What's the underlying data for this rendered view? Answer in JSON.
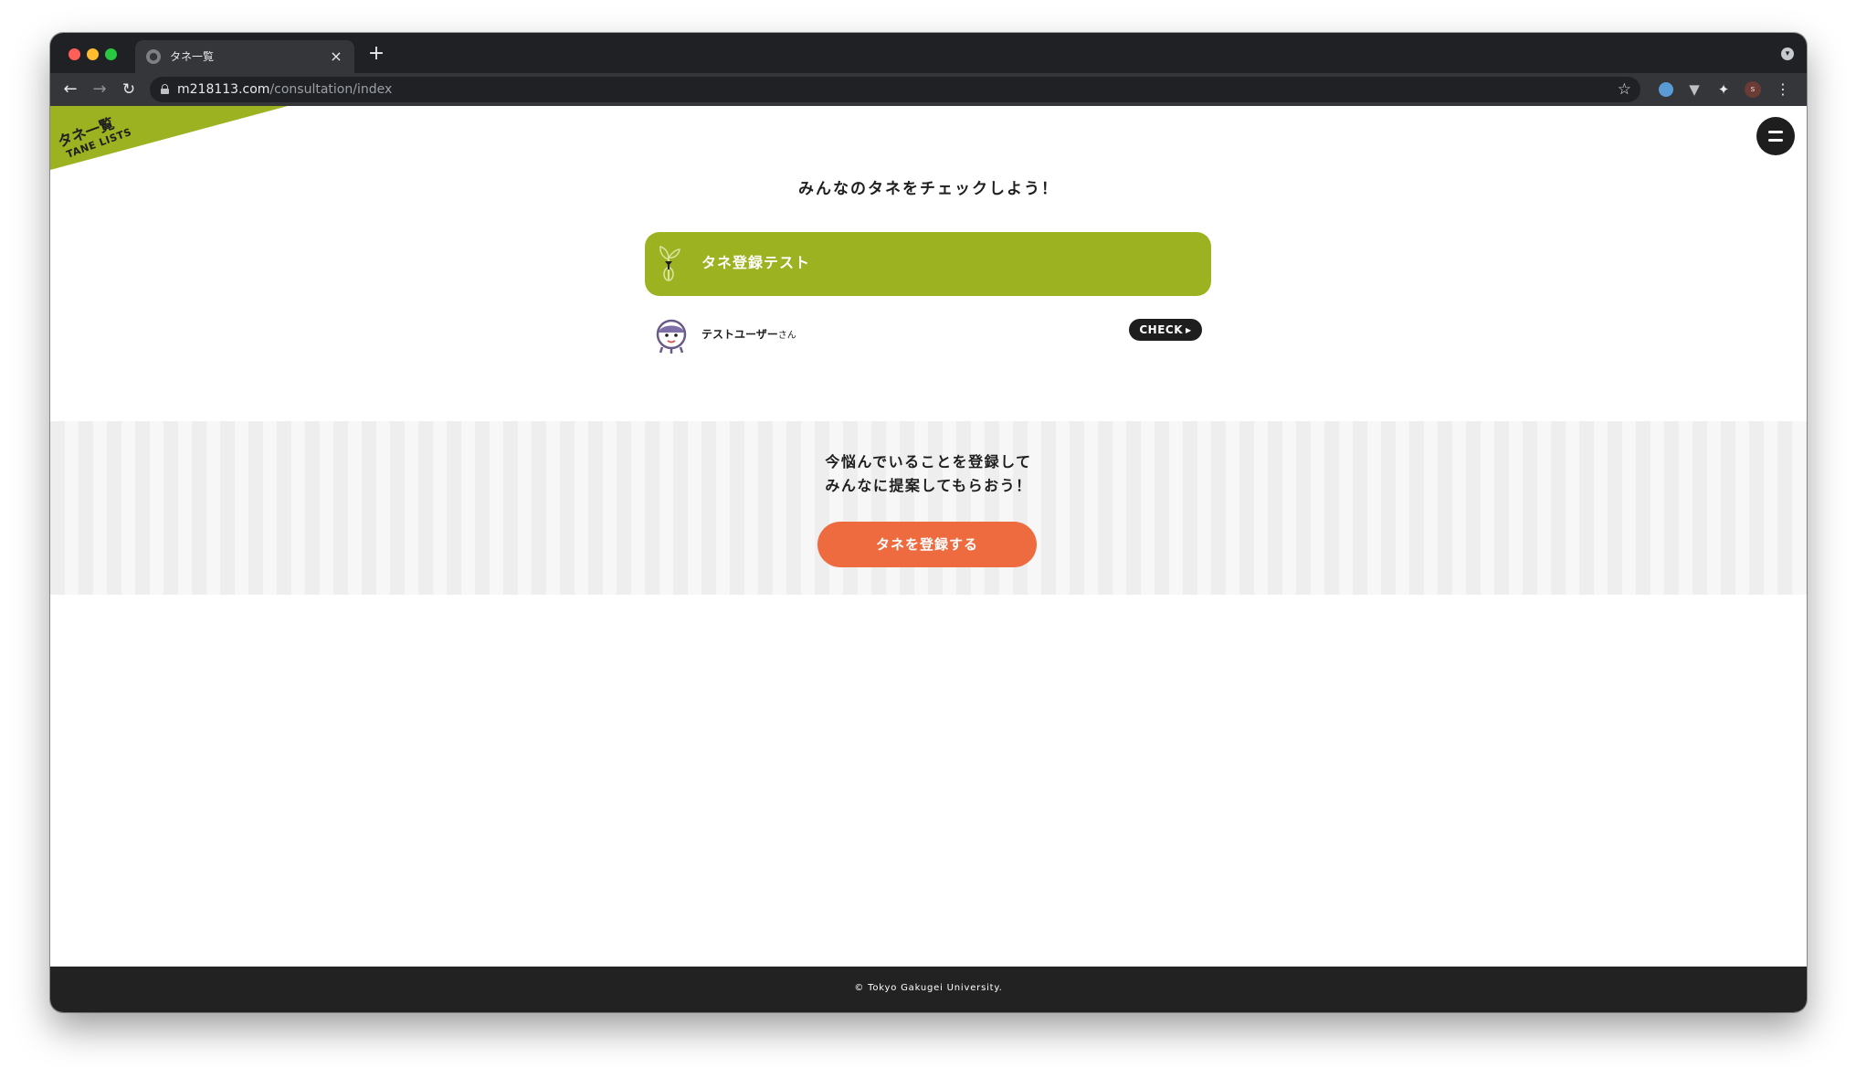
{
  "browser": {
    "tab_title": "タネ一覧",
    "url_host": "m218113.com",
    "url_path": "/consultation/index",
    "profile_initial": "s"
  },
  "page": {
    "ribbon_title": "タネ一覧",
    "ribbon_subtitle": "TANE LISTS",
    "heading": "みんなのタネをチェックしよう！",
    "cards": [
      {
        "title": "タネ登録テスト",
        "user": "テストユーザー",
        "user_suffix": "さん",
        "check_label": "CHECK"
      }
    ],
    "cta": {
      "line1": "今悩んでいることを登録して",
      "line2": "みんなに提案してもらおう！",
      "button_label": "タネを登録する"
    },
    "footer": "© Tokyo Gakugei University."
  },
  "colors": {
    "brand_green": "#9cb220",
    "cta_orange": "#ee6b40",
    "dark": "#1e1e1e"
  },
  "icons": [
    "globe-icon",
    "close-icon",
    "plus-icon",
    "back-arrow-icon",
    "forward-arrow-icon",
    "reload-icon",
    "lock-icon",
    "star-icon",
    "extension-icon",
    "puzzle-icon",
    "kebab-menu-icon",
    "hamburger-menu-icon",
    "sprout-icon",
    "mascot-avatar"
  ]
}
